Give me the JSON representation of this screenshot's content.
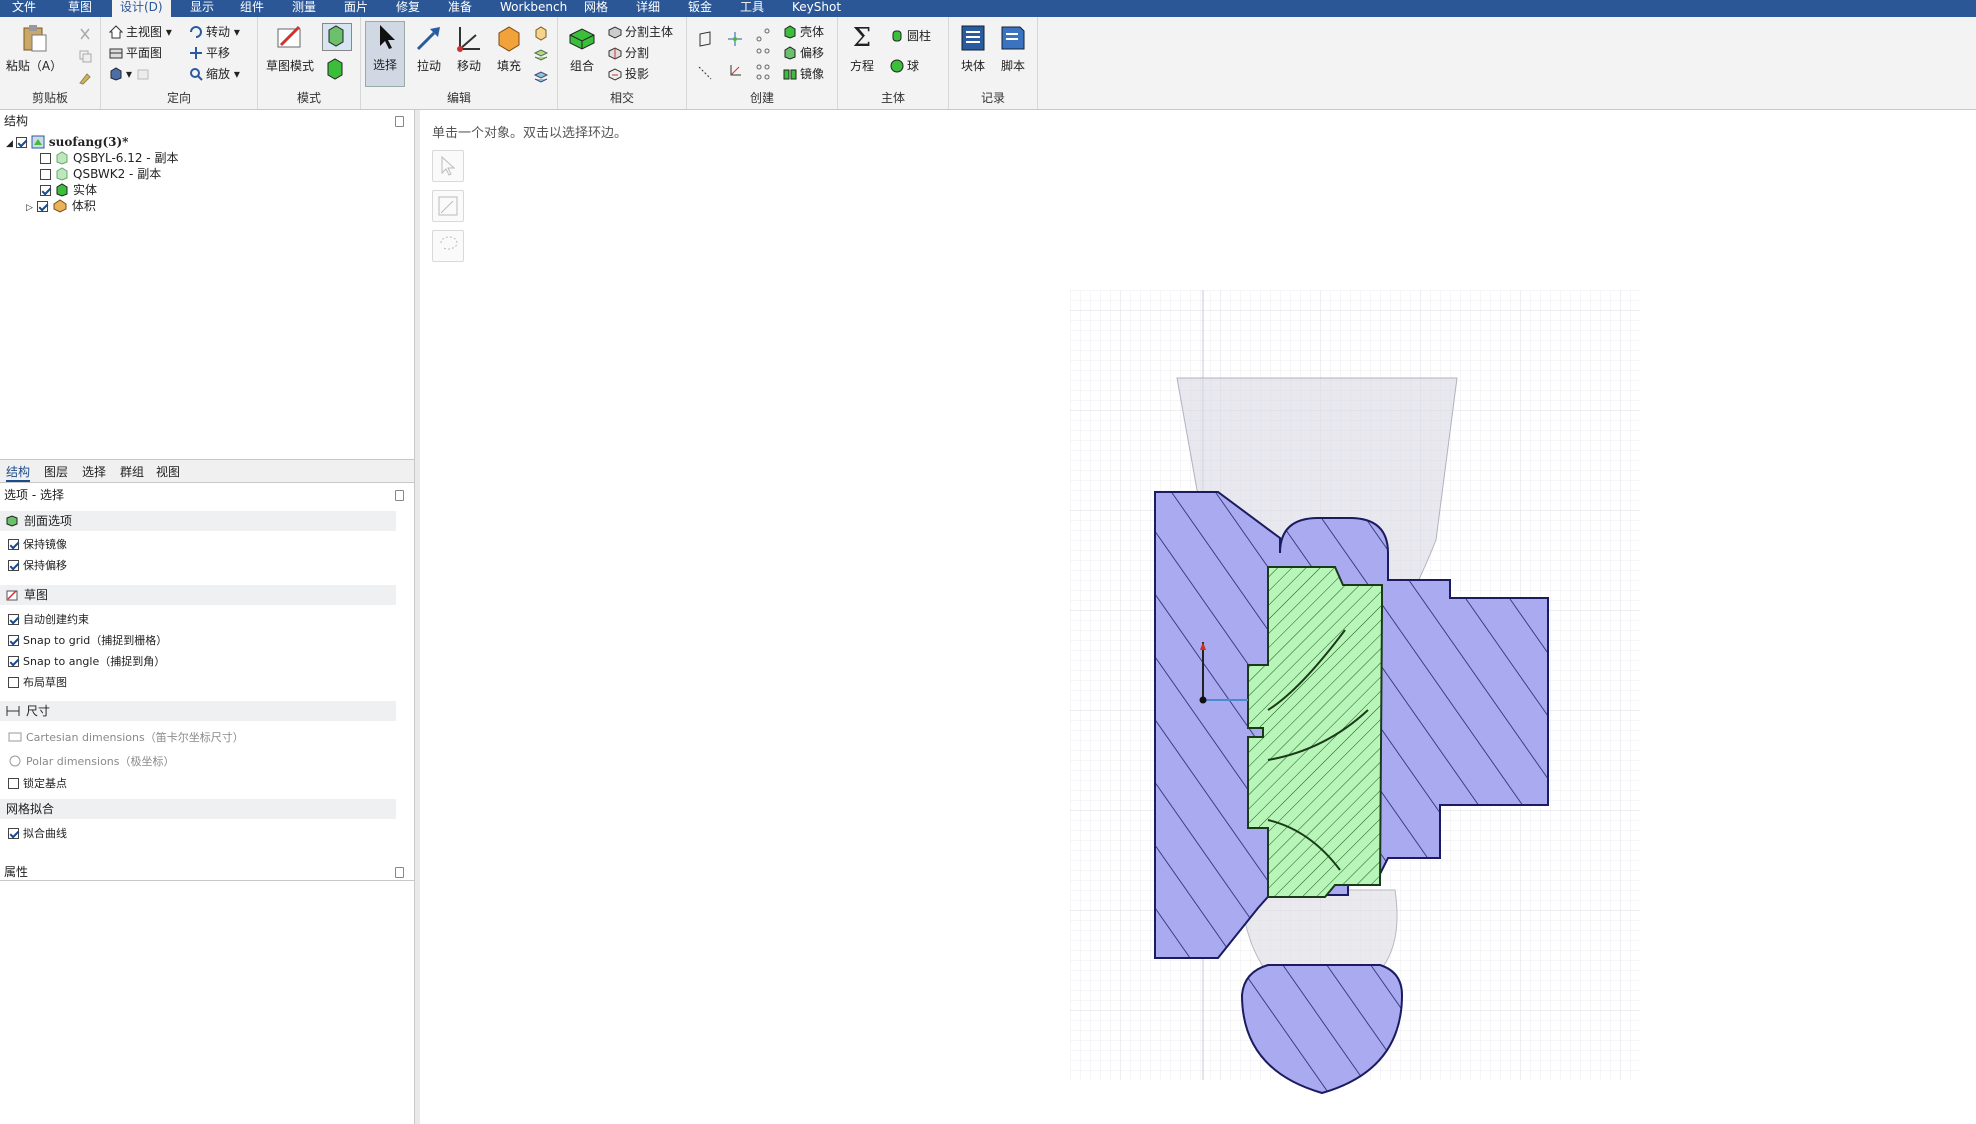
{
  "menu": {
    "tabs": [
      "文件",
      "草图",
      "设计(D)",
      "显示",
      "组件",
      "测量",
      "面片",
      "修复",
      "准备",
      "Workbench",
      "网格",
      "详细",
      "钣金",
      "工具",
      "KeyShot"
    ],
    "active_index": 2
  },
  "ribbon": {
    "clipboard": {
      "paste": "粘贴（A）",
      "label": "剪贴板"
    },
    "orient": {
      "home_view": "主视图",
      "plan_view": "平面图",
      "rotate": "转动",
      "pan": "平移",
      "zoom": "缩放",
      "label": "定向"
    },
    "mode": {
      "sketch_mode": "草图模式",
      "label": "模式"
    },
    "edit": {
      "select": "选择",
      "pull": "拉动",
      "move": "移动",
      "fill": "填充",
      "label": "编辑"
    },
    "intersect": {
      "combine": "组合",
      "split_body": "分割主体",
      "split": "分割",
      "project": "投影",
      "label": "相交"
    },
    "create": {
      "shell": "壳体",
      "offset": "偏移",
      "mirror": "镜像",
      "label": "创建"
    },
    "body": {
      "equation": "方程",
      "cylinder": "圆柱",
      "sphere": "球",
      "label": "主体"
    },
    "record": {
      "block": "块体",
      "script": "脚本",
      "label": "记录"
    }
  },
  "structure": {
    "header": "结构",
    "root": "suofang(3)*",
    "items": [
      {
        "label": "QSBYL-6.12 - 副本",
        "checked": false
      },
      {
        "label": "QSBWK2 - 副本",
        "checked": false
      },
      {
        "label": "实体",
        "checked": true
      },
      {
        "label": "体积",
        "checked": true
      }
    ]
  },
  "panel_tabs": [
    "结构",
    "图层",
    "选择",
    "群组",
    "视图"
  ],
  "options": {
    "header": "选项 - 选择",
    "sections": {
      "section_view": "剖面选项",
      "sketch": "草图",
      "dimensions": "尺寸",
      "mesh": "网格拟合"
    },
    "rows": {
      "keep_mirror": "保持镜像",
      "keep_offset": "保持偏移",
      "auto_constraints": "自动创建约束",
      "snap_grid": "Snap to grid（捕捉到栅格）",
      "snap_angle": "Snap to angle（捕捉到角）",
      "layout_sketch": "布局草图",
      "cartesian": "Cartesian dimensions（笛卡尔坐标尺寸）",
      "polar": "Polar dimensions（极坐标）",
      "lock_points": "锁定基点",
      "fit_curves": "拟合曲线"
    }
  },
  "properties": {
    "header": "属性"
  },
  "viewport": {
    "hint": "单击一个对象。双击以选择环边。"
  },
  "colors": {
    "menubar": "#2b5797",
    "body_fill": "#aaaaf0",
    "impeller_fill": "#b8f5b8",
    "outline": "#1b1b60"
  }
}
